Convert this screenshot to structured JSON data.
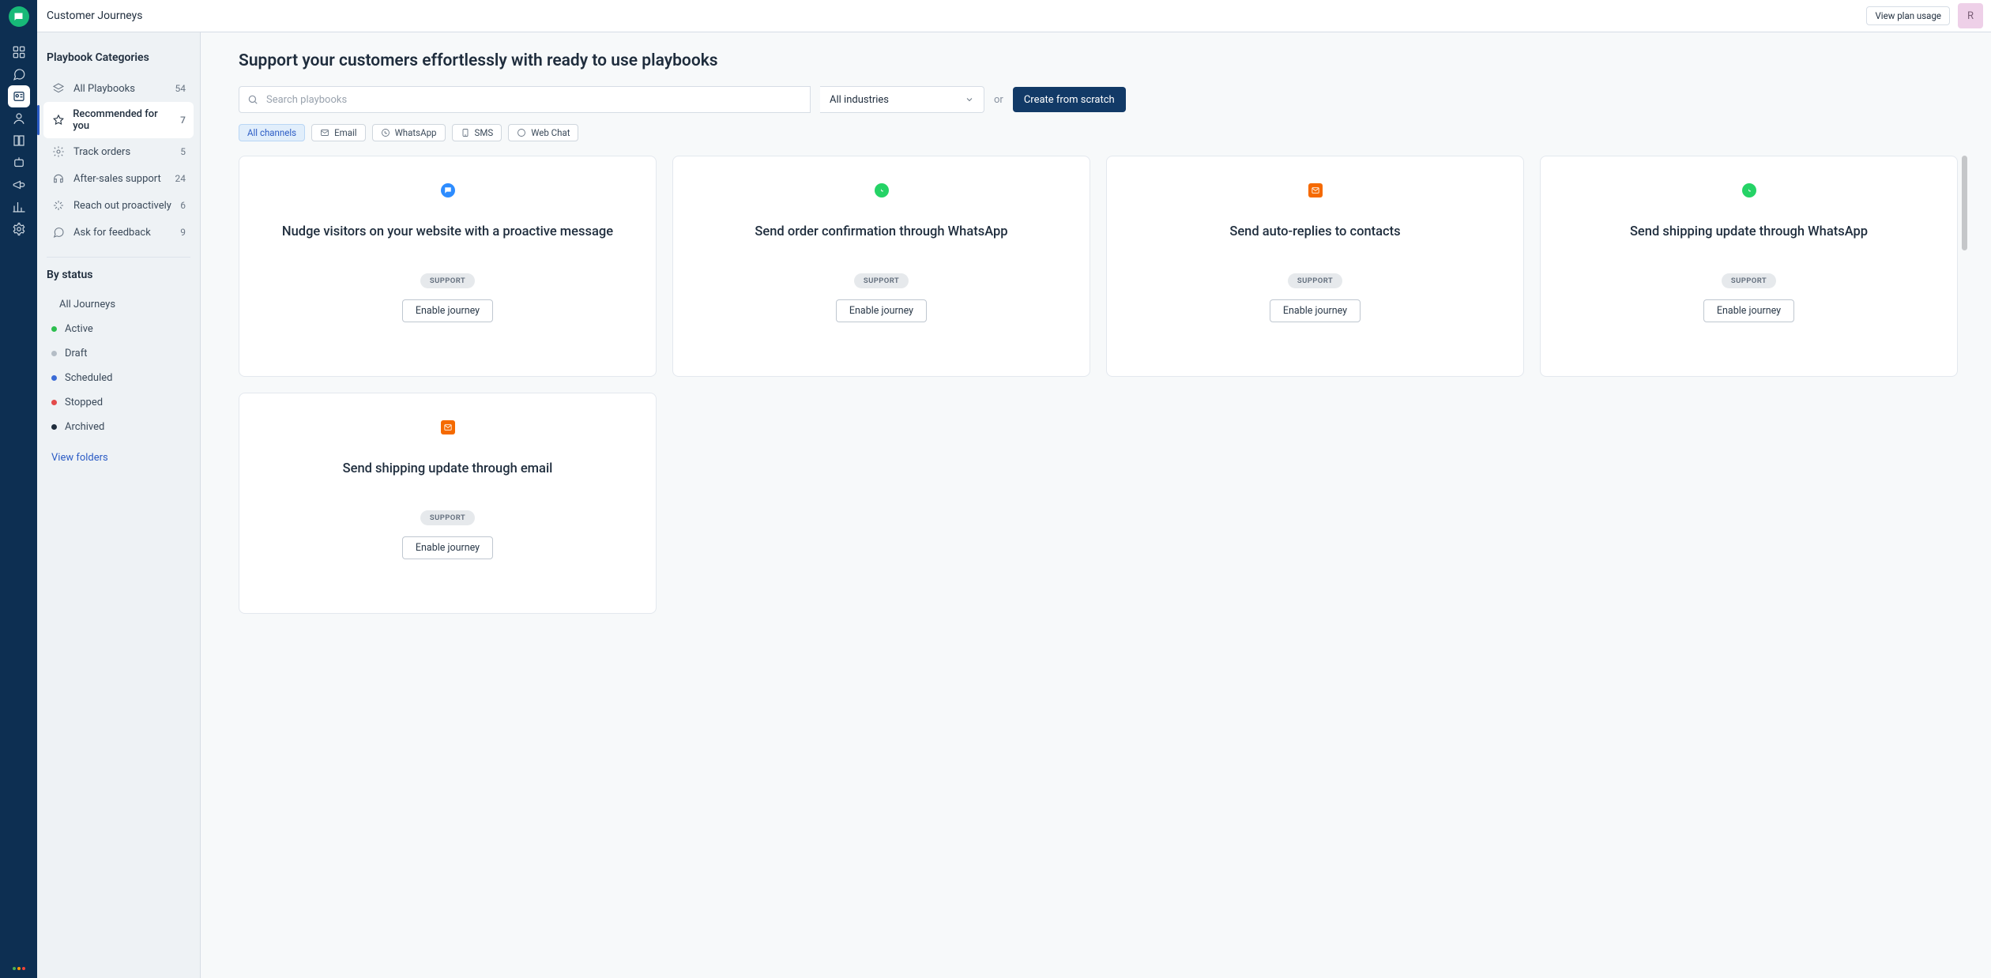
{
  "app_title": "Customer Journeys",
  "header": {
    "view_plan_usage": "View plan usage",
    "avatar_initial": "R"
  },
  "sidebar": {
    "categories_heading": "Playbook Categories",
    "categories": [
      {
        "icon": "stack",
        "label": "All Playbooks",
        "count": "54"
      },
      {
        "icon": "star",
        "label": "Recommended for you",
        "count": "7",
        "active": true
      },
      {
        "icon": "gear",
        "label": "Track orders",
        "count": "5"
      },
      {
        "icon": "headset",
        "label": "After-sales support",
        "count": "24"
      },
      {
        "icon": "spark",
        "label": "Reach out proactively",
        "count": "6"
      },
      {
        "icon": "chat",
        "label": "Ask for feedback",
        "count": "9"
      }
    ],
    "status_heading": "By status",
    "all_journeys": {
      "icon": "tree",
      "label": "All Journeys"
    },
    "statuses": [
      {
        "color": "#2cbe4e",
        "label": "Active"
      },
      {
        "color": "#b4bdc6",
        "label": "Draft"
      },
      {
        "color": "#3b6bd6",
        "label": "Scheduled"
      },
      {
        "color": "#e34b4b",
        "label": "Stopped"
      },
      {
        "color": "#1f2d3d",
        "label": "Archived"
      }
    ],
    "view_folders": "View folders"
  },
  "main": {
    "heading": "Support your customers effortlessly with ready to use playbooks",
    "search_placeholder": "Search playbooks",
    "industry_label": "All industries",
    "or_label": "or",
    "create_label": "Create from scratch",
    "channels": [
      {
        "icon": "all",
        "label": "All channels",
        "active": true
      },
      {
        "icon": "email",
        "label": "Email"
      },
      {
        "icon": "whatsapp",
        "label": "WhatsApp"
      },
      {
        "icon": "sms",
        "label": "SMS"
      },
      {
        "icon": "webchat",
        "label": "Web Chat"
      }
    ],
    "cards": [
      {
        "channel": "chat",
        "title": "Nudge visitors on your website with a proactive message",
        "tag": "SUPPORT",
        "cta": "Enable journey"
      },
      {
        "channel": "whatsapp",
        "title": "Send order confirmation through WhatsApp",
        "tag": "SUPPORT",
        "cta": "Enable journey"
      },
      {
        "channel": "email",
        "title": "Send auto-replies to contacts",
        "tag": "SUPPORT",
        "cta": "Enable journey"
      },
      {
        "channel": "whatsapp",
        "title": "Send shipping update through WhatsApp",
        "tag": "SUPPORT",
        "cta": "Enable journey"
      },
      {
        "channel": "email",
        "title": "Send shipping update through email",
        "tag": "SUPPORT",
        "cta": "Enable journey"
      }
    ]
  },
  "nav_items": [
    {
      "name": "dashboard-icon",
      "kind": "dashboard"
    },
    {
      "name": "conversations-icon",
      "kind": "chat"
    },
    {
      "name": "journeys-icon",
      "kind": "journey",
      "active": true
    },
    {
      "name": "contacts-icon",
      "kind": "contact"
    },
    {
      "name": "book-icon",
      "kind": "book"
    },
    {
      "name": "bot-icon",
      "kind": "bot"
    },
    {
      "name": "campaigns-icon",
      "kind": "megaphone"
    },
    {
      "name": "reports-icon",
      "kind": "reports"
    },
    {
      "name": "settings-icon",
      "kind": "settings"
    }
  ]
}
